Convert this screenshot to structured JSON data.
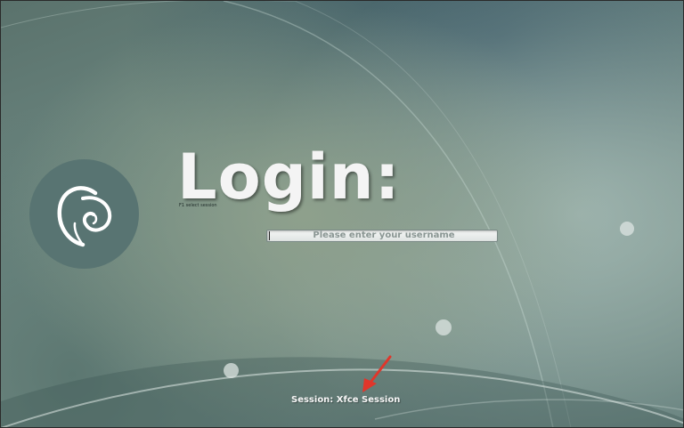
{
  "login": {
    "title": "Login:",
    "hint": "F1 select session",
    "username_placeholder": "Please enter your username",
    "username_value": ""
  },
  "footer": {
    "session_label": "Session: Xfce Session"
  },
  "icons": {
    "logo": "debian-swirl-icon",
    "annotation": "red-arrow-annotation"
  },
  "colors": {
    "accent_arrow": "#e0362b",
    "logo_circle": "#587472",
    "text": "#f4f4f4"
  }
}
